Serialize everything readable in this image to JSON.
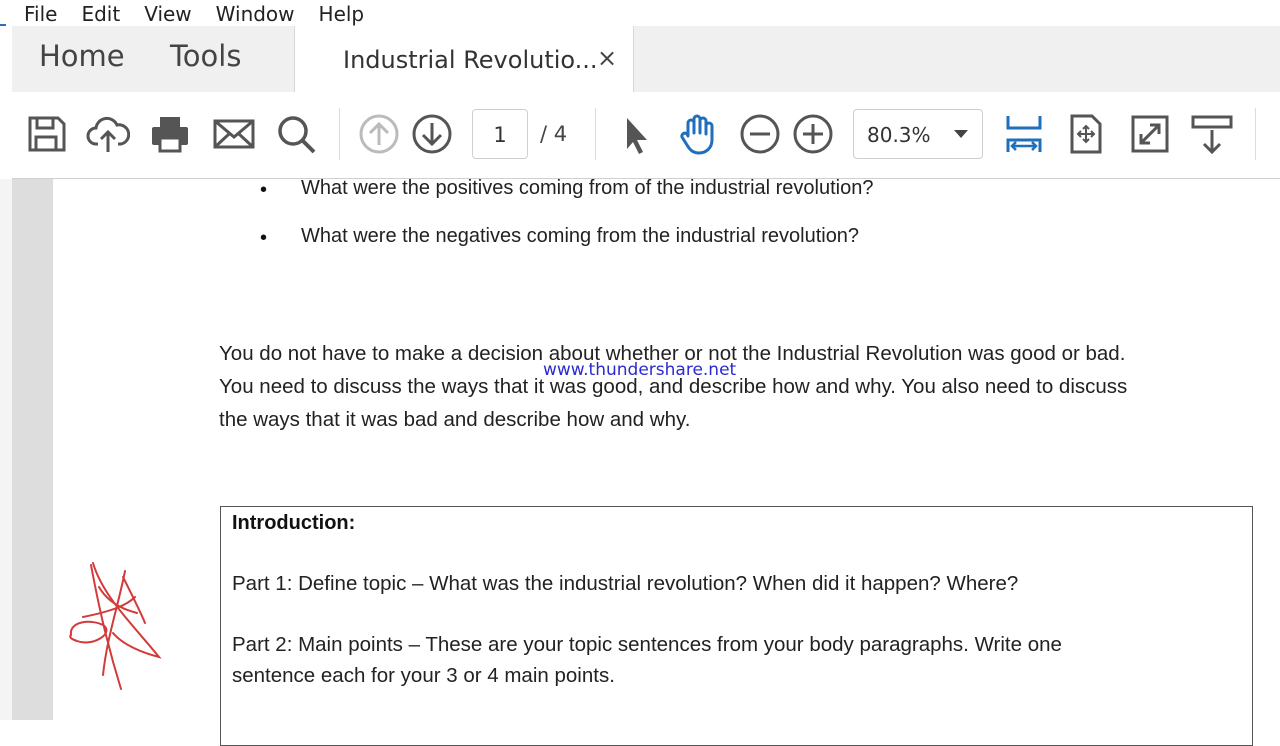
{
  "menu": [
    "File",
    "Edit",
    "View",
    "Window",
    "Help"
  ],
  "tabs": {
    "home": "Home",
    "tools": "Tools",
    "document": "Industrial Revolutio...",
    "close": "×"
  },
  "toolbar": {
    "page_current": "1",
    "page_total": "/ 4",
    "zoom": "80.3%",
    "icons": [
      "save-icon",
      "upload-icon",
      "print-icon",
      "mail-icon",
      "search-icon",
      "prev-page-icon",
      "next-page-icon",
      "select-arrow-icon",
      "hand-icon",
      "zoom-out-icon",
      "zoom-in-icon",
      "fit-width-icon",
      "fit-page-icon",
      "fullscreen-icon",
      "scroll-icon"
    ],
    "accent": "#1f6fbd"
  },
  "document": {
    "bullets": [
      "What were the positives coming from of the industrial revolution?",
      "What were the negatives coming from the industrial revolution?"
    ],
    "bullet_symbol": "•",
    "paragraph": [
      "You do not have to make a decision about whether or not the Industrial Revolution was good or bad.",
      "You need to discuss the ways that it was good, and describe how and why. You also need to discuss",
      "the ways that it was bad and describe how and why."
    ],
    "watermark": "www.thundershare.net",
    "intro": {
      "title": "Introduction:",
      "lines": [
        "Part 1: Define topic – What was the industrial revolution? When did it happen? Where?",
        "Part 2: Main points – These are your topic sentences from your body paragraphs. Write one",
        "sentence each for your 3 or 4 main points."
      ]
    }
  }
}
